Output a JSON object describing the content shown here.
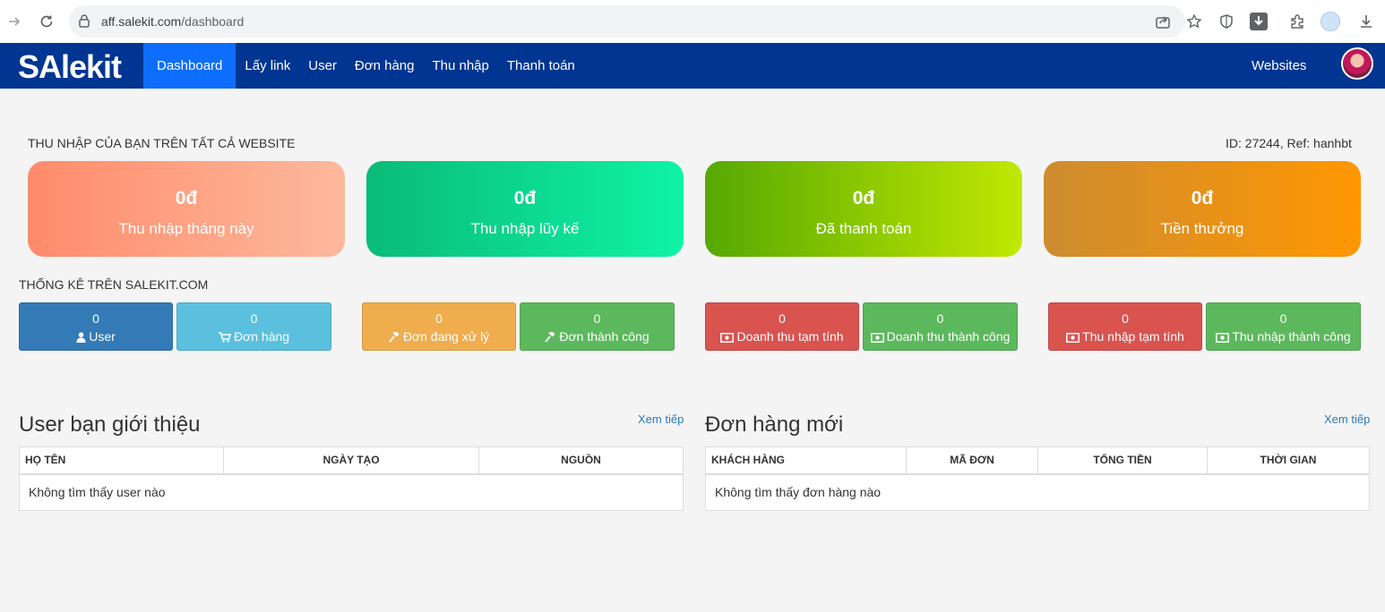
{
  "browser": {
    "url_host": "aff.salekit.com",
    "url_path": "/dashboard"
  },
  "nav": {
    "logo": "SAlekit",
    "items": [
      {
        "label": "Dashboard"
      },
      {
        "label": "Lấy link"
      },
      {
        "label": "User"
      },
      {
        "label": "Đơn hàng"
      },
      {
        "label": "Thu nhập"
      },
      {
        "label": "Thanh toán"
      }
    ],
    "websites": "Websites"
  },
  "earnings": {
    "title": "THU NHẬP CỦA BẠN TRÊN TẤT CẢ WEBSITE",
    "id_ref": "ID: 27244, Ref: hanhbt",
    "cards": [
      {
        "amount": "0đ",
        "label": "Thu nhập tháng này"
      },
      {
        "amount": "0đ",
        "label": "Thu nhập lũy kế"
      },
      {
        "amount": "0đ",
        "label": "Đã thanh toán"
      },
      {
        "amount": "0đ",
        "label": "Tiền thưởng"
      }
    ]
  },
  "stats": {
    "title": "THỐNG KÊ TRÊN SALEKIT.COM",
    "items": [
      {
        "value": "0",
        "label": "User",
        "icon": "user-icon"
      },
      {
        "value": "0",
        "label": "Đơn hàng",
        "icon": "cart-icon"
      },
      {
        "value": "0",
        "label": "Đơn đang xử lý",
        "icon": "gavel-icon"
      },
      {
        "value": "0",
        "label": "Đơn thành công",
        "icon": "gavel-icon"
      },
      {
        "value": "0",
        "label": "Doanh thu tạm tính",
        "icon": "money-icon"
      },
      {
        "value": "0",
        "label": "Doanh thu thành công",
        "icon": "money-icon"
      },
      {
        "value": "0",
        "label": "Thu nhập tạm tính",
        "icon": "money-icon"
      },
      {
        "value": "0",
        "label": "Thu nhập thành công",
        "icon": "money-icon"
      }
    ]
  },
  "users_panel": {
    "title": "User bạn giới thiệu",
    "more": "Xem tiếp",
    "columns": [
      "HỌ TÊN",
      "NGÀY TẠO",
      "NGUỒN"
    ],
    "empty": "Không tìm thấy user nào"
  },
  "orders_panel": {
    "title": "Đơn hàng mới",
    "more": "Xem tiếp",
    "columns": [
      "KHÁCH HÀNG",
      "MÃ ĐƠN",
      "TỔNG TIỀN",
      "THỜI GIAN"
    ],
    "empty": "Không tìm thấy đơn hàng nào"
  }
}
